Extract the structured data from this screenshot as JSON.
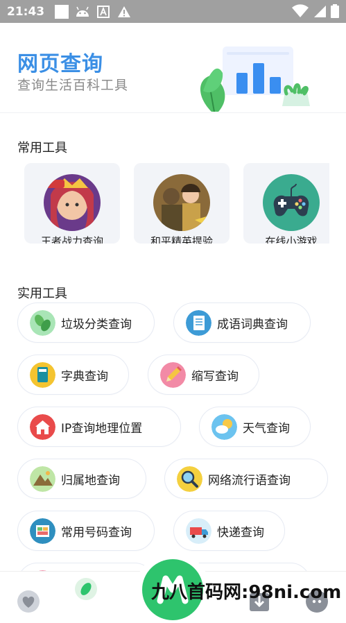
{
  "status_bar": {
    "time": "21:43"
  },
  "header": {
    "title": "网页查询",
    "subtitle": "查询生活百科工具"
  },
  "common_tools": {
    "title": "常用工具",
    "items": [
      {
        "label": "王者战力查询",
        "icon": "hero-portrait-icon"
      },
      {
        "label": "和平精英提验",
        "icon": "soldier-portrait-icon"
      },
      {
        "label": "在线小游戏",
        "icon": "gamepad-icon"
      }
    ]
  },
  "utility_tools": {
    "title": "实用工具",
    "items": [
      {
        "label": "垃圾分类查询",
        "icon": "leaves-icon"
      },
      {
        "label": "成语词典查询",
        "icon": "notebook-icon"
      },
      {
        "label": "字典查询",
        "icon": "book-icon"
      },
      {
        "label": "缩写查询",
        "icon": "pencil-icon"
      },
      {
        "label": "IP查询地理位置",
        "icon": "house-icon"
      },
      {
        "label": "天气查询",
        "icon": "weather-icon"
      },
      {
        "label": "归属地查询",
        "icon": "mountain-icon"
      },
      {
        "label": "网络流行语查询",
        "icon": "magnifier-icon"
      },
      {
        "label": "常用号码查询",
        "icon": "panel-icon"
      },
      {
        "label": "快递查询",
        "icon": "delivery-truck-icon"
      }
    ]
  },
  "watermark": "九八首码网:98ni.com",
  "colors": {
    "accent": "#3b8fe5",
    "green": "#2ec46d",
    "status_bar": "#a0a0a0"
  }
}
